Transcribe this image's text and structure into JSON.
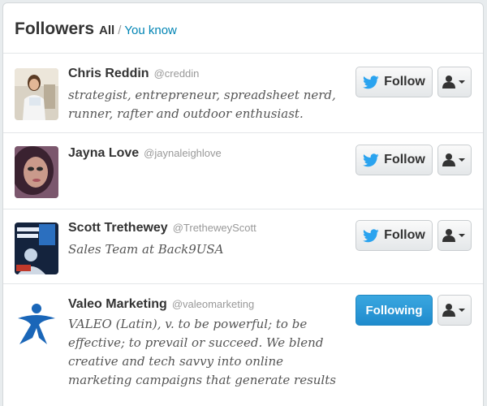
{
  "header": {
    "title": "Followers",
    "all_label": "All",
    "separator": "/",
    "you_know_label": "You know"
  },
  "users": [
    {
      "name": "Chris Reddin",
      "handle": "@creddin",
      "bio": "strategist, entrepreneur, spreadsheet nerd, runner, rafter and outdoor enthusiast.",
      "button_label": "Follow",
      "following": false
    },
    {
      "name": "Jayna Love",
      "handle": "@jaynaleighlove",
      "bio": "",
      "button_label": "Follow",
      "following": false
    },
    {
      "name": "Scott Trethewey",
      "handle": "@TretheweyScott",
      "bio": "Sales Team at Back9USA",
      "button_label": "Follow",
      "following": false
    },
    {
      "name": "Valeo Marketing",
      "handle": "@valeomarketing",
      "bio": "VALEO (Latin), v. to be powerful; to be effective; to prevail or succeed. We blend creative and tech savvy into online marketing campaigns that generate results",
      "button_label": "Following",
      "following": true
    }
  ],
  "icons": {
    "follow_icon": "bird-icon",
    "user_actions_icon": "user-icon",
    "dropdown_icon": "caret-down-icon"
  },
  "colors": {
    "bird_blue": "#2aa3ef",
    "link_blue": "#0084b4",
    "following_blue": "#2b9bdb"
  }
}
